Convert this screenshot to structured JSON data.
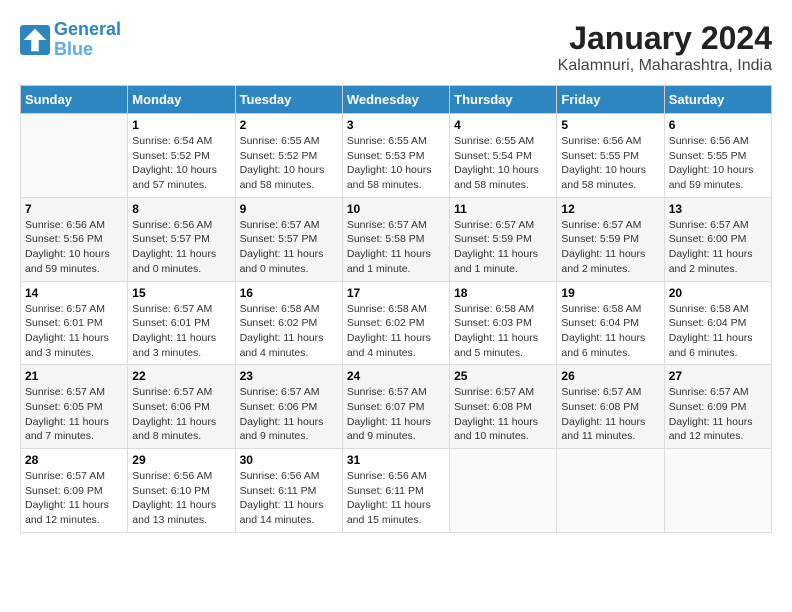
{
  "logo": {
    "line1": "General",
    "line2": "Blue"
  },
  "title": "January 2024",
  "subtitle": "Kalamnuri, Maharashtra, India",
  "weekdays": [
    "Sunday",
    "Monday",
    "Tuesday",
    "Wednesday",
    "Thursday",
    "Friday",
    "Saturday"
  ],
  "weeks": [
    [
      {
        "day": "",
        "sunrise": "",
        "sunset": "",
        "daylight": ""
      },
      {
        "day": "1",
        "sunrise": "Sunrise: 6:54 AM",
        "sunset": "Sunset: 5:52 PM",
        "daylight": "Daylight: 10 hours and 57 minutes."
      },
      {
        "day": "2",
        "sunrise": "Sunrise: 6:55 AM",
        "sunset": "Sunset: 5:52 PM",
        "daylight": "Daylight: 10 hours and 58 minutes."
      },
      {
        "day": "3",
        "sunrise": "Sunrise: 6:55 AM",
        "sunset": "Sunset: 5:53 PM",
        "daylight": "Daylight: 10 hours and 58 minutes."
      },
      {
        "day": "4",
        "sunrise": "Sunrise: 6:55 AM",
        "sunset": "Sunset: 5:54 PM",
        "daylight": "Daylight: 10 hours and 58 minutes."
      },
      {
        "day": "5",
        "sunrise": "Sunrise: 6:56 AM",
        "sunset": "Sunset: 5:55 PM",
        "daylight": "Daylight: 10 hours and 58 minutes."
      },
      {
        "day": "6",
        "sunrise": "Sunrise: 6:56 AM",
        "sunset": "Sunset: 5:55 PM",
        "daylight": "Daylight: 10 hours and 59 minutes."
      }
    ],
    [
      {
        "day": "7",
        "sunrise": "Sunrise: 6:56 AM",
        "sunset": "Sunset: 5:56 PM",
        "daylight": "Daylight: 10 hours and 59 minutes."
      },
      {
        "day": "8",
        "sunrise": "Sunrise: 6:56 AM",
        "sunset": "Sunset: 5:57 PM",
        "daylight": "Daylight: 11 hours and 0 minutes."
      },
      {
        "day": "9",
        "sunrise": "Sunrise: 6:57 AM",
        "sunset": "Sunset: 5:57 PM",
        "daylight": "Daylight: 11 hours and 0 minutes."
      },
      {
        "day": "10",
        "sunrise": "Sunrise: 6:57 AM",
        "sunset": "Sunset: 5:58 PM",
        "daylight": "Daylight: 11 hours and 1 minute."
      },
      {
        "day": "11",
        "sunrise": "Sunrise: 6:57 AM",
        "sunset": "Sunset: 5:59 PM",
        "daylight": "Daylight: 11 hours and 1 minute."
      },
      {
        "day": "12",
        "sunrise": "Sunrise: 6:57 AM",
        "sunset": "Sunset: 5:59 PM",
        "daylight": "Daylight: 11 hours and 2 minutes."
      },
      {
        "day": "13",
        "sunrise": "Sunrise: 6:57 AM",
        "sunset": "Sunset: 6:00 PM",
        "daylight": "Daylight: 11 hours and 2 minutes."
      }
    ],
    [
      {
        "day": "14",
        "sunrise": "Sunrise: 6:57 AM",
        "sunset": "Sunset: 6:01 PM",
        "daylight": "Daylight: 11 hours and 3 minutes."
      },
      {
        "day": "15",
        "sunrise": "Sunrise: 6:57 AM",
        "sunset": "Sunset: 6:01 PM",
        "daylight": "Daylight: 11 hours and 3 minutes."
      },
      {
        "day": "16",
        "sunrise": "Sunrise: 6:58 AM",
        "sunset": "Sunset: 6:02 PM",
        "daylight": "Daylight: 11 hours and 4 minutes."
      },
      {
        "day": "17",
        "sunrise": "Sunrise: 6:58 AM",
        "sunset": "Sunset: 6:02 PM",
        "daylight": "Daylight: 11 hours and 4 minutes."
      },
      {
        "day": "18",
        "sunrise": "Sunrise: 6:58 AM",
        "sunset": "Sunset: 6:03 PM",
        "daylight": "Daylight: 11 hours and 5 minutes."
      },
      {
        "day": "19",
        "sunrise": "Sunrise: 6:58 AM",
        "sunset": "Sunset: 6:04 PM",
        "daylight": "Daylight: 11 hours and 6 minutes."
      },
      {
        "day": "20",
        "sunrise": "Sunrise: 6:58 AM",
        "sunset": "Sunset: 6:04 PM",
        "daylight": "Daylight: 11 hours and 6 minutes."
      }
    ],
    [
      {
        "day": "21",
        "sunrise": "Sunrise: 6:57 AM",
        "sunset": "Sunset: 6:05 PM",
        "daylight": "Daylight: 11 hours and 7 minutes."
      },
      {
        "day": "22",
        "sunrise": "Sunrise: 6:57 AM",
        "sunset": "Sunset: 6:06 PM",
        "daylight": "Daylight: 11 hours and 8 minutes."
      },
      {
        "day": "23",
        "sunrise": "Sunrise: 6:57 AM",
        "sunset": "Sunset: 6:06 PM",
        "daylight": "Daylight: 11 hours and 9 minutes."
      },
      {
        "day": "24",
        "sunrise": "Sunrise: 6:57 AM",
        "sunset": "Sunset: 6:07 PM",
        "daylight": "Daylight: 11 hours and 9 minutes."
      },
      {
        "day": "25",
        "sunrise": "Sunrise: 6:57 AM",
        "sunset": "Sunset: 6:08 PM",
        "daylight": "Daylight: 11 hours and 10 minutes."
      },
      {
        "day": "26",
        "sunrise": "Sunrise: 6:57 AM",
        "sunset": "Sunset: 6:08 PM",
        "daylight": "Daylight: 11 hours and 11 minutes."
      },
      {
        "day": "27",
        "sunrise": "Sunrise: 6:57 AM",
        "sunset": "Sunset: 6:09 PM",
        "daylight": "Daylight: 11 hours and 12 minutes."
      }
    ],
    [
      {
        "day": "28",
        "sunrise": "Sunrise: 6:57 AM",
        "sunset": "Sunset: 6:09 PM",
        "daylight": "Daylight: 11 hours and 12 minutes."
      },
      {
        "day": "29",
        "sunrise": "Sunrise: 6:56 AM",
        "sunset": "Sunset: 6:10 PM",
        "daylight": "Daylight: 11 hours and 13 minutes."
      },
      {
        "day": "30",
        "sunrise": "Sunrise: 6:56 AM",
        "sunset": "Sunset: 6:11 PM",
        "daylight": "Daylight: 11 hours and 14 minutes."
      },
      {
        "day": "31",
        "sunrise": "Sunrise: 6:56 AM",
        "sunset": "Sunset: 6:11 PM",
        "daylight": "Daylight: 11 hours and 15 minutes."
      },
      {
        "day": "",
        "sunrise": "",
        "sunset": "",
        "daylight": ""
      },
      {
        "day": "",
        "sunrise": "",
        "sunset": "",
        "daylight": ""
      },
      {
        "day": "",
        "sunrise": "",
        "sunset": "",
        "daylight": ""
      }
    ]
  ]
}
